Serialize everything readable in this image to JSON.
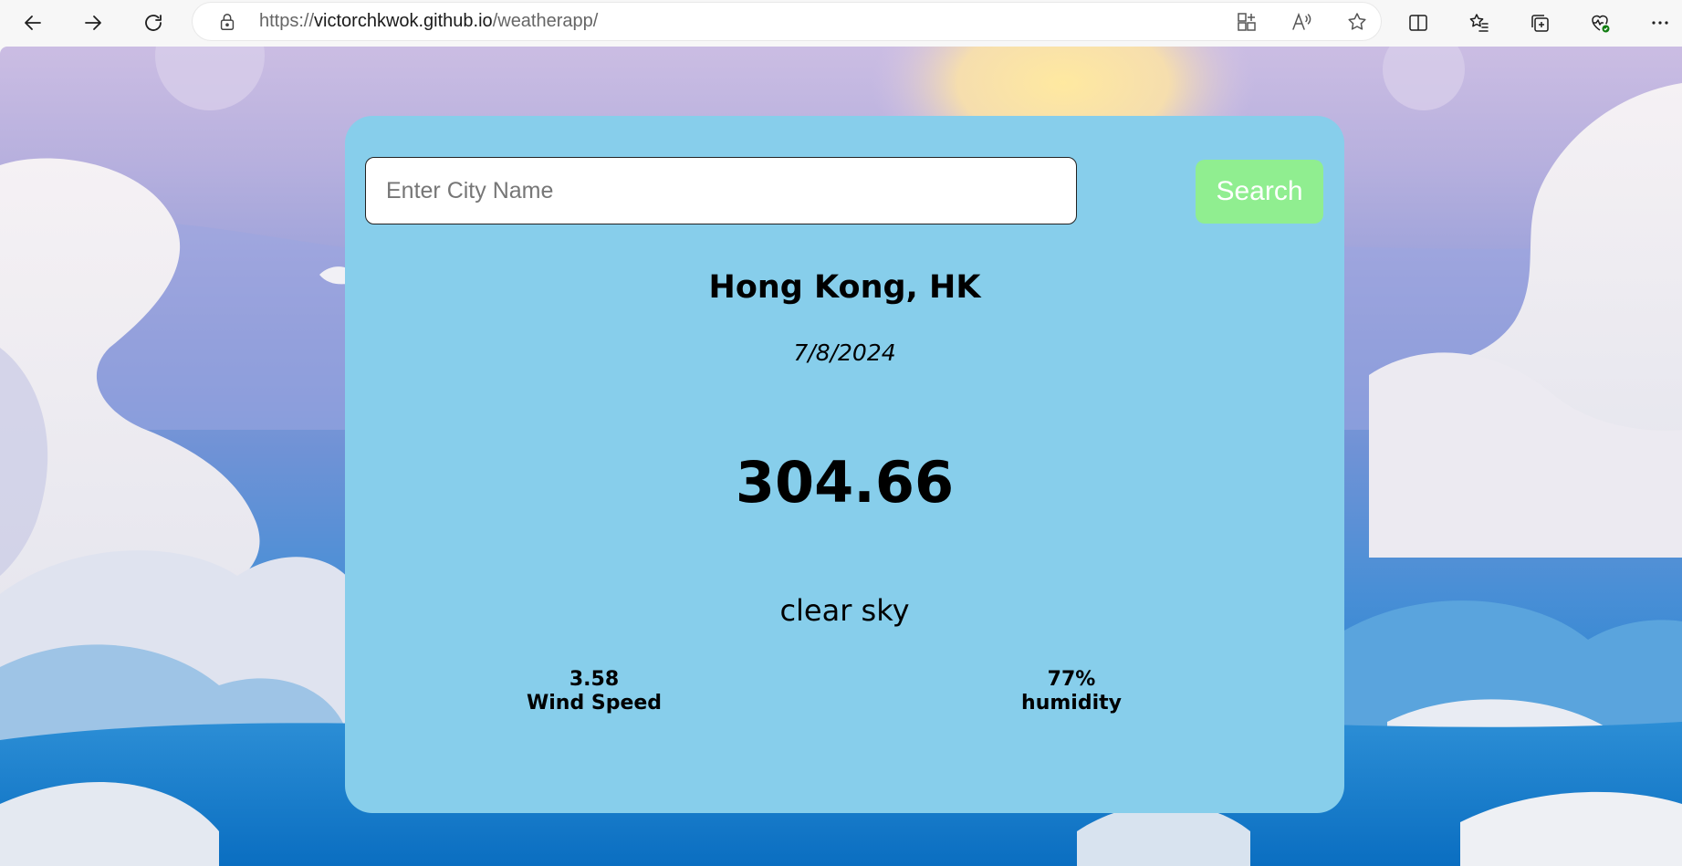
{
  "browser": {
    "url_scheme": "https://",
    "url_host": "victorchkwok.github.io",
    "url_path": "/weatherapp/",
    "icons": {
      "back": "back-arrow-icon",
      "forward": "forward-arrow-icon",
      "refresh": "refresh-icon",
      "lock": "lock-icon",
      "apps": "app-available-icon",
      "read_aloud": "read-aloud-icon",
      "favorite": "star-icon",
      "split_screen": "split-screen-icon",
      "favorites": "favorites-icon",
      "collections": "collections-icon",
      "browser_essentials": "browser-essentials-icon",
      "more": "more-icon"
    }
  },
  "weather": {
    "search_placeholder": "Enter City Name",
    "search_value": "",
    "search_button": "Search",
    "city": "Hong Kong, HK",
    "date": "7/8/2024",
    "temperature": "304.66",
    "description": "clear sky",
    "wind_speed_value": "3.58",
    "wind_speed_label": "Wind Speed",
    "humidity_value": "77%",
    "humidity_label": "humidity"
  },
  "colors": {
    "card": "#87ceeb",
    "search_button": "#90ee90"
  }
}
